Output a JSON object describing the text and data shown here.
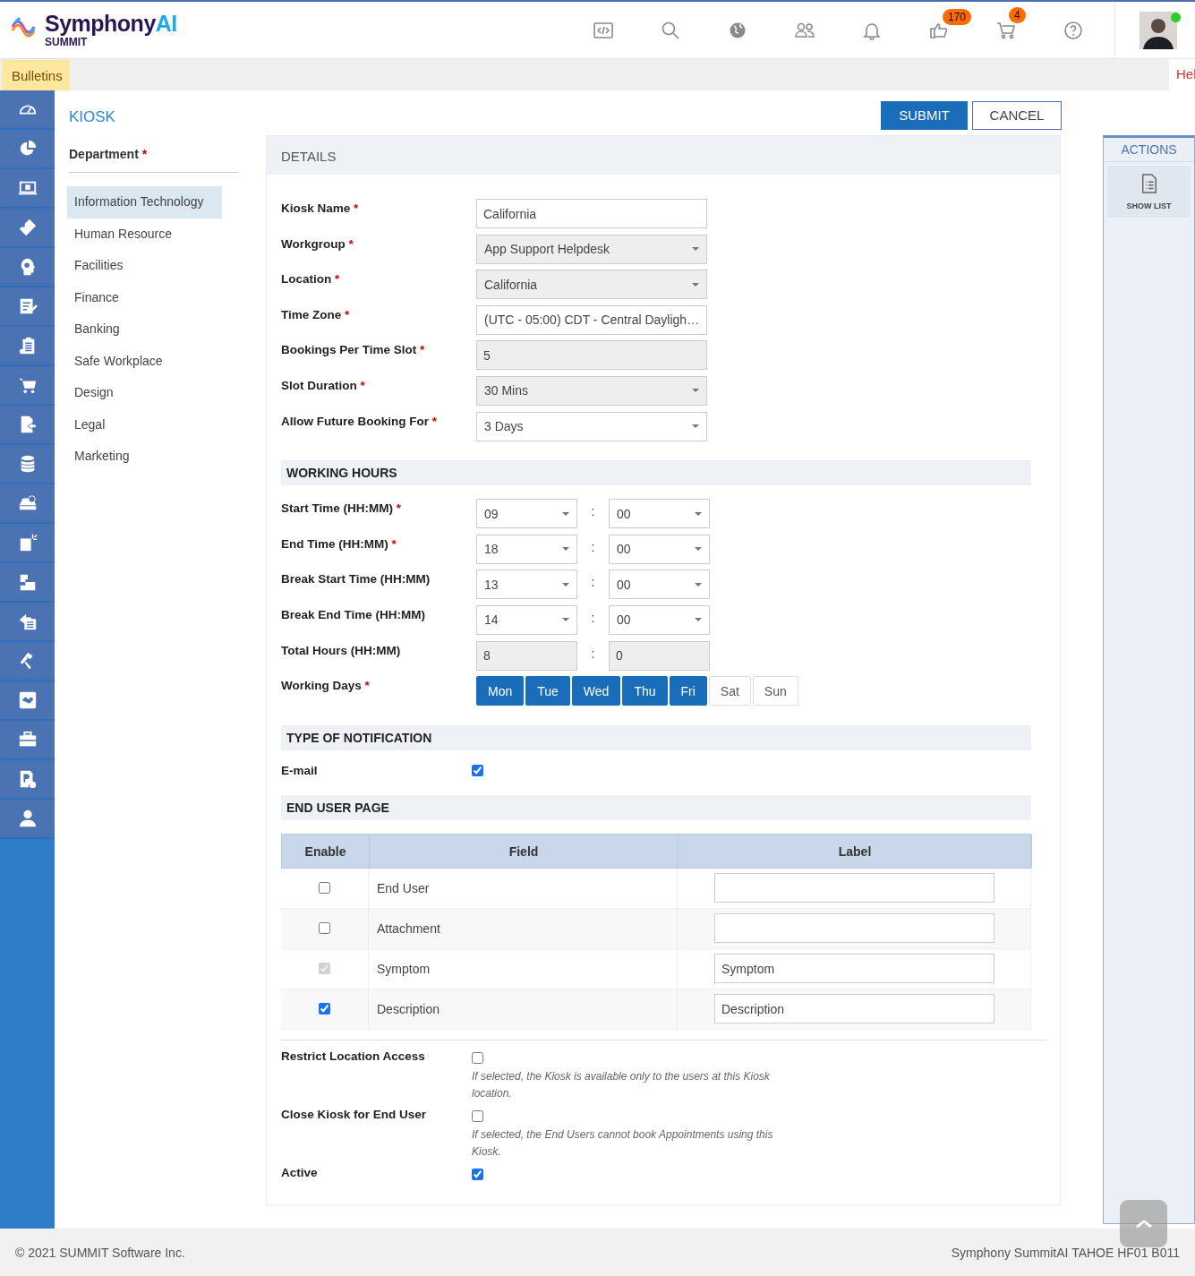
{
  "header": {
    "logo": {
      "wordmark": "Symphony",
      "accent": "AI",
      "product": "SUMMIT"
    },
    "badges": [
      "170",
      "4"
    ],
    "user": {
      "online": true
    }
  },
  "bulletin_bar": {
    "tab": "Bulletins",
    "help_link": "Hel"
  },
  "page": {
    "title": "KIOSK",
    "buttons": [
      {
        "label": "SUBMIT",
        "kind": "primary"
      },
      {
        "label": "CANCEL",
        "kind": "secondary"
      }
    ]
  },
  "department": {
    "label": "Department",
    "asterisk": "*",
    "items": [
      {
        "label": "Information Technology",
        "selected": true
      },
      {
        "label": "Human Resource",
        "selected": false
      },
      {
        "label": "Facilities",
        "selected": false
      },
      {
        "label": "Finance",
        "selected": false
      },
      {
        "label": "Banking",
        "selected": false
      },
      {
        "label": "Safe Workplace",
        "selected": false
      },
      {
        "label": "Design",
        "selected": false
      },
      {
        "label": "Legal",
        "selected": false
      },
      {
        "label": "Marketing",
        "selected": false
      }
    ]
  },
  "details": {
    "title": "DETAILS",
    "fields": [
      {
        "label": "Kiosk Name",
        "asterisk": "*",
        "kind": "input",
        "value": "California",
        "disabled": false
      },
      {
        "label": "Workgroup",
        "asterisk": "*",
        "kind": "select",
        "value": "App Support Helpdesk",
        "disabled": true
      },
      {
        "label": "Location",
        "asterisk": "*",
        "kind": "select",
        "value": "California",
        "disabled": true
      },
      {
        "label": "Time Zone",
        "asterisk": "*",
        "kind": "select",
        "value": "(UTC - 05:00) CDT - Central Dayligh…",
        "disabled": false
      },
      {
        "label": "Bookings Per Time Slot",
        "asterisk": "*",
        "kind": "input",
        "value": "5",
        "disabled": true
      },
      {
        "label": "Slot Duration",
        "asterisk": "*",
        "kind": "select",
        "value": "30 Mins",
        "disabled": true
      },
      {
        "label": "Allow Future Booking For",
        "asterisk": "*",
        "kind": "select",
        "value": "3 Days",
        "disabled": false
      }
    ]
  },
  "working_hours": {
    "title": "WORKING HOURS",
    "separator": ":",
    "rows": [
      {
        "label": "Start Time (HH:MM)",
        "asterisk": "*",
        "kind": "select",
        "hours": "09",
        "minutes": "00"
      },
      {
        "label": "End Time (HH:MM)",
        "asterisk": "*",
        "kind": "select",
        "hours": "18",
        "minutes": "00"
      },
      {
        "label": "Break Start Time (HH:MM)",
        "kind": "select",
        "hours": "13",
        "minutes": "00"
      },
      {
        "label": "Break End Time (HH:MM)",
        "kind": "select",
        "hours": "14",
        "minutes": "00"
      },
      {
        "label": "Total Hours (HH:MM)",
        "kind": "input",
        "hours": "8",
        "minutes": "0"
      }
    ],
    "working_days": {
      "label": "Working Days",
      "asterisk": "*",
      "days": [
        {
          "label": "Mon",
          "selected": true
        },
        {
          "label": "Tue",
          "selected": true
        },
        {
          "label": "Wed",
          "selected": true
        },
        {
          "label": "Thu",
          "selected": true
        },
        {
          "label": "Fri",
          "selected": true
        },
        {
          "label": "Sat",
          "selected": false
        },
        {
          "label": "Sun",
          "selected": false
        }
      ]
    }
  },
  "notification": {
    "title": "TYPE OF NOTIFICATION",
    "options": [
      {
        "label": "E-mail",
        "checked": true
      }
    ]
  },
  "end_user_page": {
    "title": "END USER PAGE",
    "columns": [
      "Enable",
      "Field",
      "Label"
    ],
    "rows": [
      {
        "checked": false,
        "disabled": false,
        "field": "End User"
      },
      {
        "checked": false,
        "disabled": false,
        "field": "Attachment"
      },
      {
        "checked": true,
        "disabled": true,
        "field": "Symptom",
        "label": "Symptom"
      },
      {
        "checked": true,
        "disabled": false,
        "field": "Description",
        "label": "Description"
      }
    ]
  },
  "options": [
    {
      "label": "Restrict Location Access",
      "checked": false,
      "hint": "If selected, the Kiosk is available only to the users at this Kiosk location."
    },
    {
      "label": "Close Kiosk for End User",
      "checked": false,
      "hint": "If selected, the End Users cannot book Appointments using this Kiosk."
    },
    {
      "label": "Active",
      "checked": true
    }
  ],
  "actions": {
    "title": "ACTIONS",
    "items": [
      {
        "label": "SHOW LIST"
      }
    ]
  },
  "footer": {
    "copyright": "© 2021 SUMMIT Software Inc.",
    "version": "Symphony SummitAI TAHOE HF01 B011"
  }
}
